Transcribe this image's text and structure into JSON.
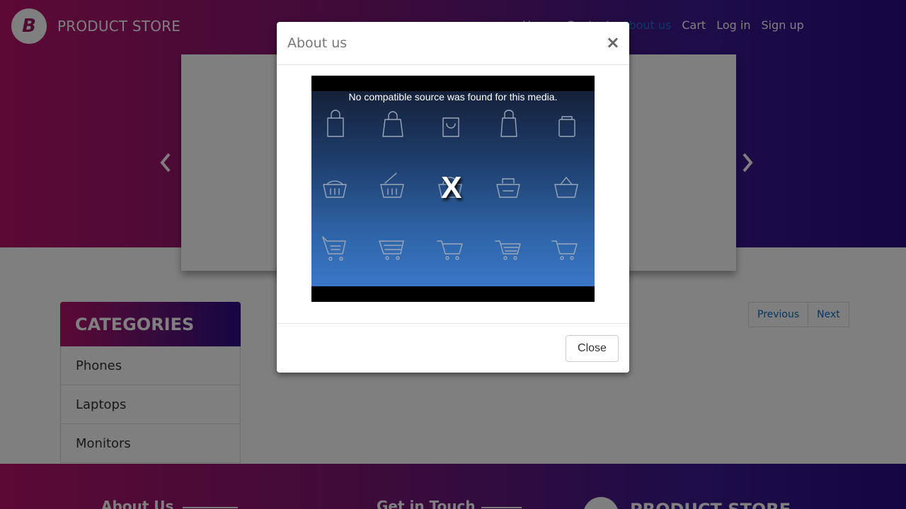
{
  "brand": {
    "logo_letter": "B",
    "name": "PRODUCT STORE"
  },
  "nav": [
    {
      "label": "Home",
      "active": false
    },
    {
      "label": "Contact",
      "active": false
    },
    {
      "label": "About us",
      "active": true
    },
    {
      "label": "Cart",
      "active": false
    },
    {
      "label": "Log in",
      "active": false
    },
    {
      "label": "Sign up",
      "active": false
    }
  ],
  "carousel": {
    "prev_icon": "chevron-left-icon",
    "next_icon": "chevron-right-icon"
  },
  "pagination": {
    "previous": "Previous",
    "next": "Next"
  },
  "categories": {
    "title": "CATEGORIES",
    "items": [
      "Phones",
      "Laptops",
      "Monitors"
    ]
  },
  "footer": {
    "about_title": "About Us",
    "contact_title": "Get in Touch",
    "brand_name": "PRODUCT STORE"
  },
  "modal": {
    "title": "About us",
    "close_symbol": "×",
    "video": {
      "error_message": "No compatible source was found for this media.",
      "error_icon": "X"
    },
    "close_button": "Close"
  },
  "colors": {
    "gradient_start": "#b8136a",
    "gradient_end": "#2a0c87",
    "link_blue": "#0d6bc4",
    "active_nav": "#1a73c8"
  }
}
